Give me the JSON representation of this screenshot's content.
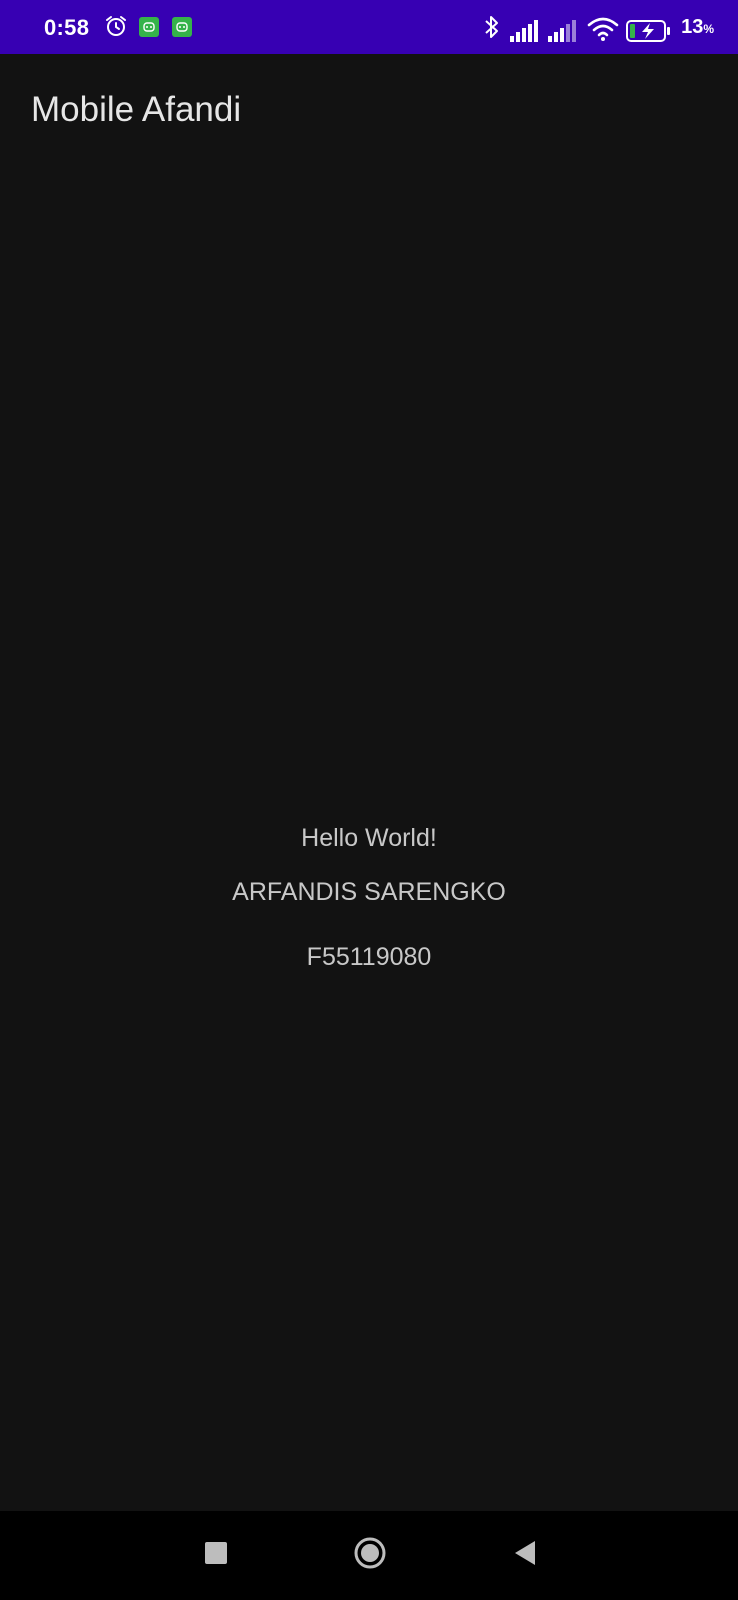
{
  "status_bar": {
    "time": "0:58",
    "battery_value": "13",
    "battery_unit": "%",
    "background": "#3700B3",
    "icons": [
      "alarm-icon",
      "app-notification-icon",
      "app-notification-icon",
      "bluetooth-icon",
      "signal-icon",
      "signal-icon",
      "wifi-icon",
      "battery-charging-icon"
    ]
  },
  "app_bar": {
    "title": "Mobile Afandi"
  },
  "main": {
    "greeting": "Hello World!",
    "name": "ARFANDIS SARENGKO",
    "student_id": "F55119080"
  },
  "nav_bar": {
    "buttons": [
      "recents-icon",
      "home-icon",
      "back-icon"
    ]
  }
}
